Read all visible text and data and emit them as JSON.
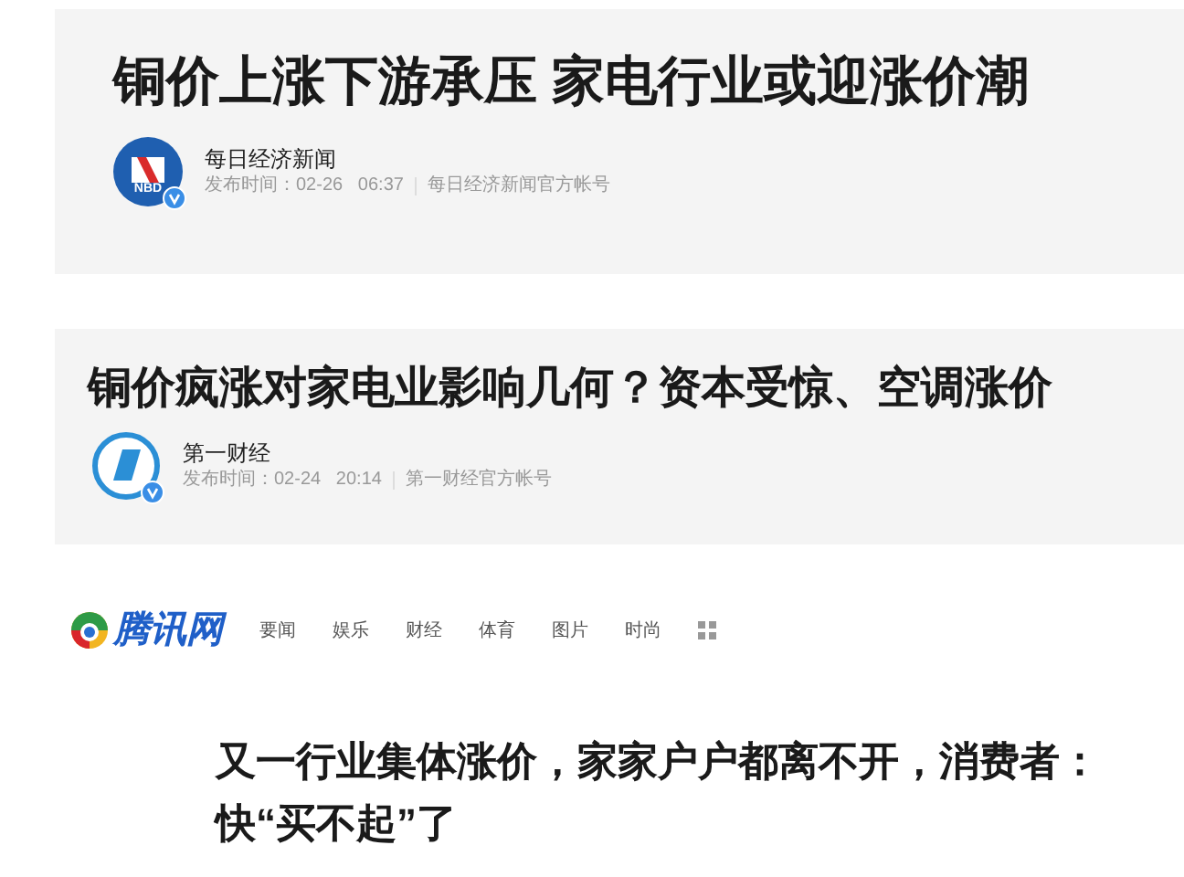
{
  "articles": [
    {
      "title": "铜价上涨下游承压 家电行业或迎涨价潮",
      "source": "每日经济新闻",
      "kind": "nbd",
      "avatar_text": "NBD",
      "verified": true,
      "meta_label": "发布时间：",
      "date": "02-26",
      "time": "06:37",
      "account": "每日经济新闻官方帐号"
    },
    {
      "title": "铜价疯涨对家电业影响几何？资本受惊、空调涨价",
      "source": "第一财经",
      "kind": "yicai",
      "verified": true,
      "meta_label": "发布时间：",
      "date": "02-24",
      "time": "20:14",
      "account": "第一财经官方帐号"
    }
  ],
  "site": {
    "logo_text": "腾讯网",
    "nav": [
      "要闻",
      "娱乐",
      "财经",
      "体育",
      "图片",
      "时尚"
    ],
    "headline_lines": [
      "又一行业集体涨价，家家户户都离不开，消费者：",
      "快“买不起”了"
    ]
  }
}
